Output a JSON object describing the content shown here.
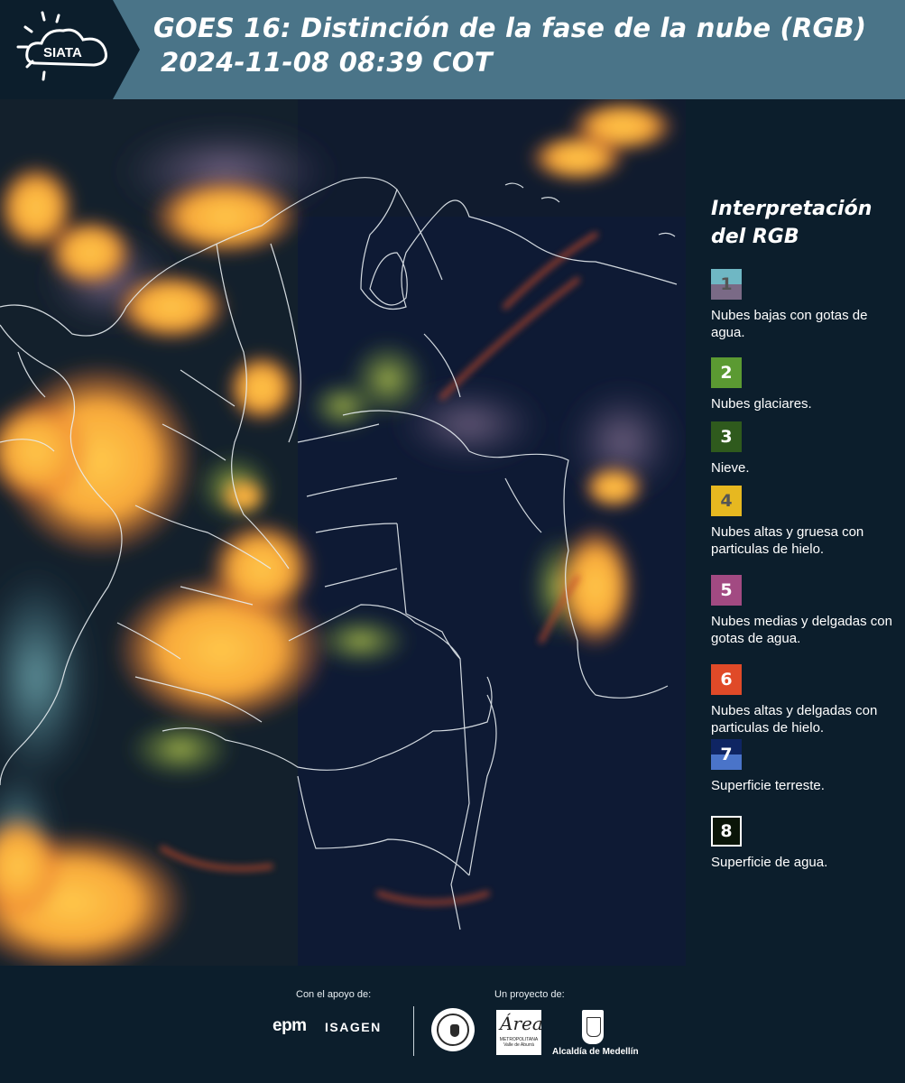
{
  "header": {
    "logo_text": "SIATA",
    "title_line1": "GOES 16: Distinción de la fase de la nube (RGB)",
    "title_line2": "2024-11-08 08:39 COT"
  },
  "legend": {
    "title_line1": "Interpretación",
    "title_line2": "del RGB",
    "items": [
      {
        "num": "1",
        "label": "Nubes bajas con gotas de agua.",
        "color_top": "#6fb7c4",
        "color_bottom": "#7a6a86",
        "text_color": "#555"
      },
      {
        "num": "2",
        "label": "Nubes glaciares.",
        "color_top": "#5b9a32",
        "color_bottom": "#5b9a32",
        "text_color": "#fff"
      },
      {
        "num": "3",
        "label": "Nieve.",
        "color_top": "#2f5a1d",
        "color_bottom": "#2f5a1d",
        "text_color": "#fff"
      },
      {
        "num": "4",
        "label": "Nubes altas y gruesa con particulas de hielo.",
        "color_top": "#e7b820",
        "color_bottom": "#e7b820",
        "text_color": "#555"
      },
      {
        "num": "5",
        "label": "Nubes medias y delgadas con gotas de agua.",
        "color_top": "#a24a82",
        "color_bottom": "#a24a82",
        "text_color": "#fff"
      },
      {
        "num": "6",
        "label": "Nubes altas y delgadas con particulas de hielo.",
        "color_top": "#e04a28",
        "color_bottom": "#e04a28",
        "text_color": "#fff"
      },
      {
        "num": "7",
        "label": "Superficie terreste.",
        "color_top": "#0f2563",
        "color_bottom": "#4a74c9",
        "text_color": "#fff"
      },
      {
        "num": "8",
        "label": "Superficie de agua.",
        "color_top": "#0a1508",
        "color_bottom": "#0a1508",
        "text_color": "#fff"
      }
    ]
  },
  "footer": {
    "support_label": "Con el apoyo de:",
    "project_label": "Un proyecto de:",
    "sponsor1": "epm",
    "sponsor2": "ISAGEN",
    "area_script": "Área",
    "area_text": "METROPOLITANA Valle de Aburrá",
    "alcaldia": "Alcaldía de Medellín"
  }
}
